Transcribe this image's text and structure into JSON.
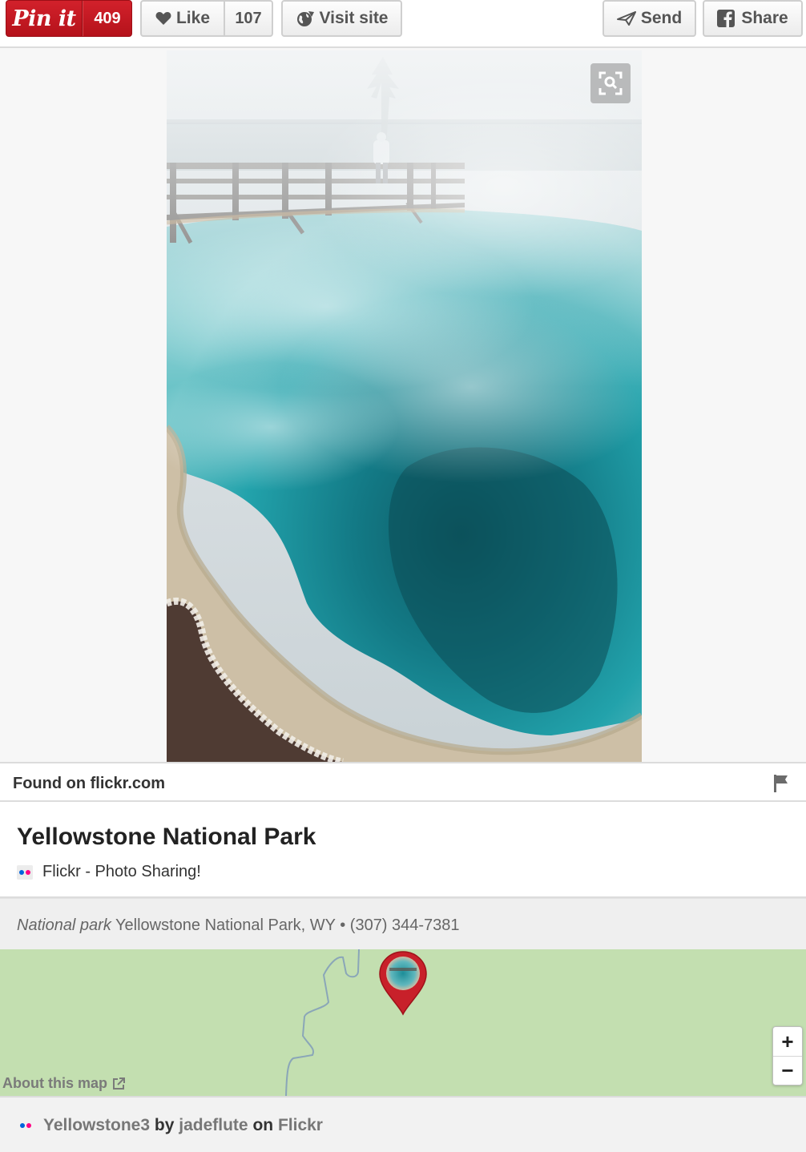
{
  "toolbar": {
    "pin_label": "Pin it",
    "pin_count": "409",
    "like_label": "Like",
    "like_count": "107",
    "visit_label": "Visit site",
    "send_label": "Send",
    "share_label": "Share"
  },
  "colors": {
    "pin_red": "#c8202a",
    "map_green": "#c3dfb0",
    "pin_marker_red": "#c8202a"
  },
  "found": {
    "label": "Found on flickr.com"
  },
  "pin": {
    "title": "Yellowstone National Park",
    "source": "Flickr - Photo Sharing!"
  },
  "place": {
    "type": "National park",
    "address": "Yellowstone National Park, WY",
    "separator": "•",
    "phone": "(307) 344-7381"
  },
  "map": {
    "about_label": "About this map",
    "zoom_in": "+",
    "zoom_out": "−"
  },
  "attribution": {
    "photo_title": "Yellowstone3",
    "by": "by",
    "author": "jadeflute",
    "on": "on",
    "site": "Flickr"
  },
  "icons": {
    "like": "heart-icon",
    "visit": "globe-icon",
    "send": "paper-plane-icon",
    "share": "facebook-icon",
    "zoom": "magnifier-icon",
    "flag": "flag-icon",
    "external": "external-link-icon"
  }
}
